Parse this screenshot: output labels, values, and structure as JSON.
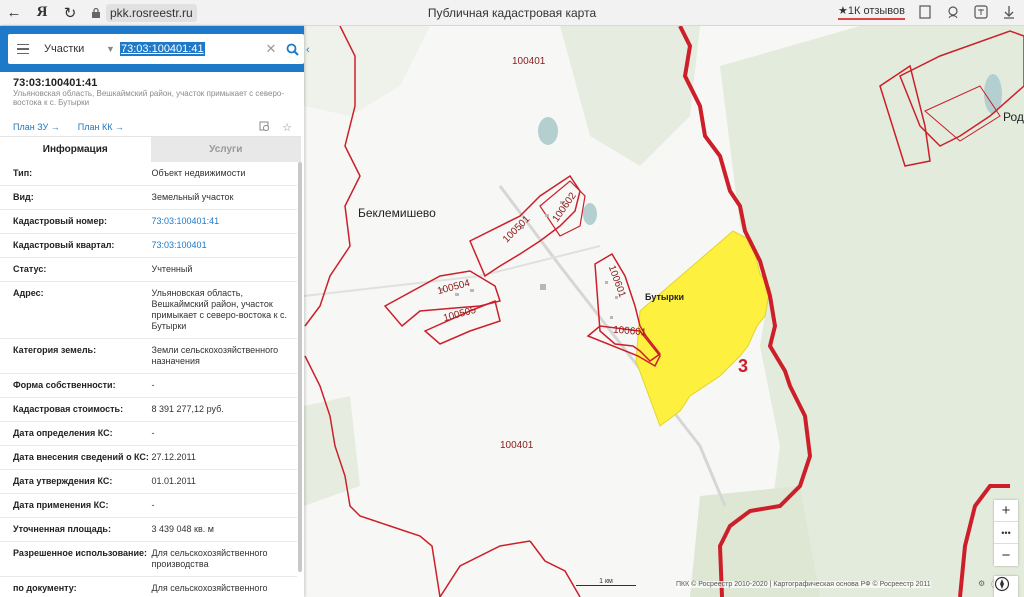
{
  "browser": {
    "back_icon": "←",
    "yandex_icon": "Я",
    "refresh_icon": "↻",
    "url": "pkk.rosreestr.ru",
    "title": "Публичная кадастровая карта",
    "reviews": "★1К отзывов"
  },
  "search": {
    "layer": "Участки",
    "query": "73:03:100401:41"
  },
  "object": {
    "title": "73:03:100401:41",
    "address": "Ульяновская область, Вешкаймский район, участок примыкает с северо-востока к с. Бутырки",
    "plan_zu": "План ЗУ →",
    "plan_kk": "План КК →"
  },
  "tabs": {
    "info": "Информация",
    "services": "Услуги"
  },
  "info_rows": [
    {
      "label": "Тип:",
      "value": "Объект недвижимости"
    },
    {
      "label": "Вид:",
      "value": "Земельный участок"
    },
    {
      "label": "Кадастровый номер:",
      "value": "73:03:100401:41"
    },
    {
      "label": "Кадастровый квартал:",
      "value": "73:03:100401"
    },
    {
      "label": "Статус:",
      "value": "Учтенный"
    },
    {
      "label": "Адрес:",
      "value": "Ульяновская область, Вешкаймский район, участок примыкает с северо-востока к с. Бутырки"
    },
    {
      "label": "Категория земель:",
      "value": "Земли сельскохозяйственного назначения"
    },
    {
      "label": "Форма собственности:",
      "value": "-"
    },
    {
      "label": "Кадастровая стоимость:",
      "value": "8 391 277,12 руб."
    },
    {
      "label": "Дата определения КС:",
      "value": "-"
    },
    {
      "label": "Дата внесения сведений о КС:",
      "value": "27.12.2011"
    },
    {
      "label": "Дата утверждения КС:",
      "value": "01.01.2011"
    },
    {
      "label": "Дата применения КС:",
      "value": "-"
    },
    {
      "label": "Уточненная площадь:",
      "value": "3 439 048 кв. м"
    },
    {
      "label": "Разрешенное использование:",
      "value": "Для сельскохозяйственного производства"
    },
    {
      "label": "по документу:",
      "value": "Для сельскохозяйственного"
    }
  ],
  "map": {
    "labels": {
      "q100401_top": "100401",
      "q100401_bottom": "100401",
      "beklemishevo": "Беклемишево",
      "butyrki": "Бутырки",
      "rod": "Род",
      "q100504": "100504",
      "q100505": "100505",
      "q100501": "100501",
      "q100602": "100602",
      "q100601a": "100601",
      "q100601b": "100601",
      "district3": "3"
    },
    "scale": "1 км",
    "copyright": "ПКК © Росреестр 2010-2020 | Картографическая основа РФ © Росреестр 2011",
    "zoom_in": "+",
    "more": "•••",
    "zoom_out": "−",
    "colors": {
      "boundary": "#cc1f2a",
      "parcel": "#fdf03e",
      "forest": "#e2ebdc",
      "search_bar": "#1e79c8"
    }
  }
}
